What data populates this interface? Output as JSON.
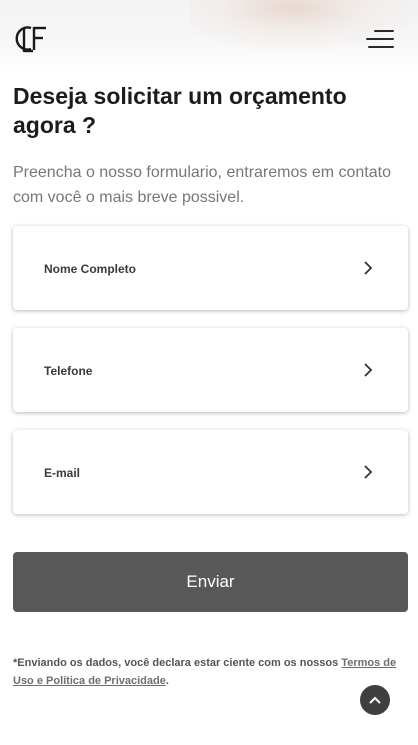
{
  "header": {
    "logo_text": "CLF",
    "menu_icon": "hamburger-menu-icon"
  },
  "main": {
    "title": "Deseja solicitar um orçamento agora ?",
    "subtitle": "Preencha o nosso formulario, entraremos em contato com você o mais breve possivel."
  },
  "form": {
    "fields": [
      {
        "label": "Nome Completo",
        "icon": "chevron-right-icon"
      },
      {
        "label": "Telefone",
        "icon": "chevron-right-icon"
      },
      {
        "label": "E-mail",
        "icon": "chevron-right-icon"
      }
    ],
    "submit_label": "Enviar"
  },
  "footer": {
    "disclaimer_text": "*Enviando os dados, você declara estar ciente com os nossos ",
    "terms_link": "Termos de Uso e Política de Privacidade",
    "disclaimer_end": ".",
    "scroll_top_icon": "arrow-up-icon"
  },
  "colors": {
    "button_bg": "#585858",
    "scroll_top_bg": "#3f3f3f",
    "text_dark": "#1c1c1c",
    "text_muted": "#777777"
  }
}
